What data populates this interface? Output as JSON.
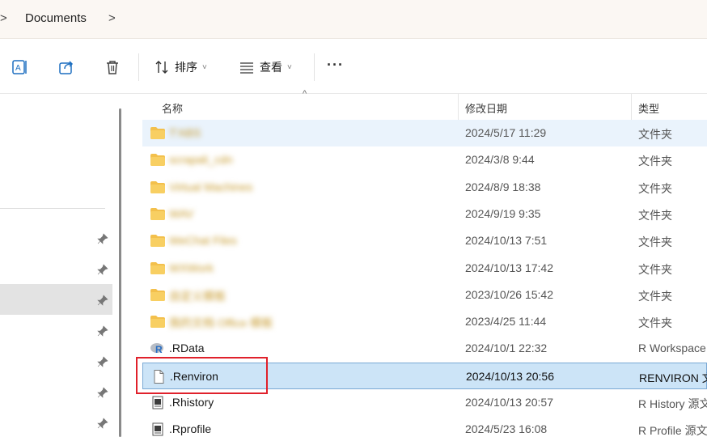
{
  "address": {
    "crumb": "Documents",
    "chevron": ">"
  },
  "toolbar": {
    "sort_label": "排序",
    "view_label": "查看",
    "more_label": "···",
    "dropdown_glyph": "˅"
  },
  "columns": {
    "name": "名称",
    "modified": "修改日期",
    "type": "类型"
  },
  "colors": {
    "folder": "#f3c04c",
    "selection": "#cce4f7",
    "annotation": "#e0212b",
    "row_hover": "#eaf3fc"
  },
  "files": [
    {
      "name": "T'ABS",
      "date": "2024/5/17 11:29",
      "type": "文件夹",
      "icon": "folder-icon",
      "blur": true,
      "hl": true
    },
    {
      "name": "scrapali_cdn",
      "date": "2024/3/8 9:44",
      "type": "文件夹",
      "icon": "folder-icon",
      "blur": true
    },
    {
      "name": "Virtual Machines",
      "date": "2024/8/9 18:38",
      "type": "文件夹",
      "icon": "folder-icon",
      "blur": true
    },
    {
      "name": "WAV",
      "date": "2024/9/19 9:35",
      "type": "文件夹",
      "icon": "folder-icon",
      "blur": true
    },
    {
      "name": "WeChat Files",
      "date": "2024/10/13 7:51",
      "type": "文件夹",
      "icon": "folder-icon",
      "blur": true
    },
    {
      "name": "WXWork",
      "date": "2024/10/13 17:42",
      "type": "文件夹",
      "icon": "folder-icon",
      "blur": true
    },
    {
      "name": "自定义模板",
      "date": "2023/10/26 15:42",
      "type": "文件夹",
      "icon": "folder-icon",
      "blur": true
    },
    {
      "name": "我的文档 Office 模板",
      "date": "2023/4/25 11:44",
      "type": "文件夹",
      "icon": "folder-icon",
      "blur": true
    },
    {
      "name": ".RData",
      "date": "2024/10/1 22:32",
      "type": "R Workspace",
      "icon": "r-workspace-icon"
    },
    {
      "name": ".Renviron",
      "date": "2024/10/13 20:56",
      "type": "RENVIRON 文件",
      "icon": "file-icon",
      "sel": true
    },
    {
      "name": ".Rhistory",
      "date": "2024/10/13 20:57",
      "type": "R History 源文件",
      "icon": "r-source-icon"
    },
    {
      "name": ".Rprofile",
      "date": "2024/5/23 16:08",
      "type": "R Profile 源文件",
      "icon": "r-source-icon"
    }
  ]
}
